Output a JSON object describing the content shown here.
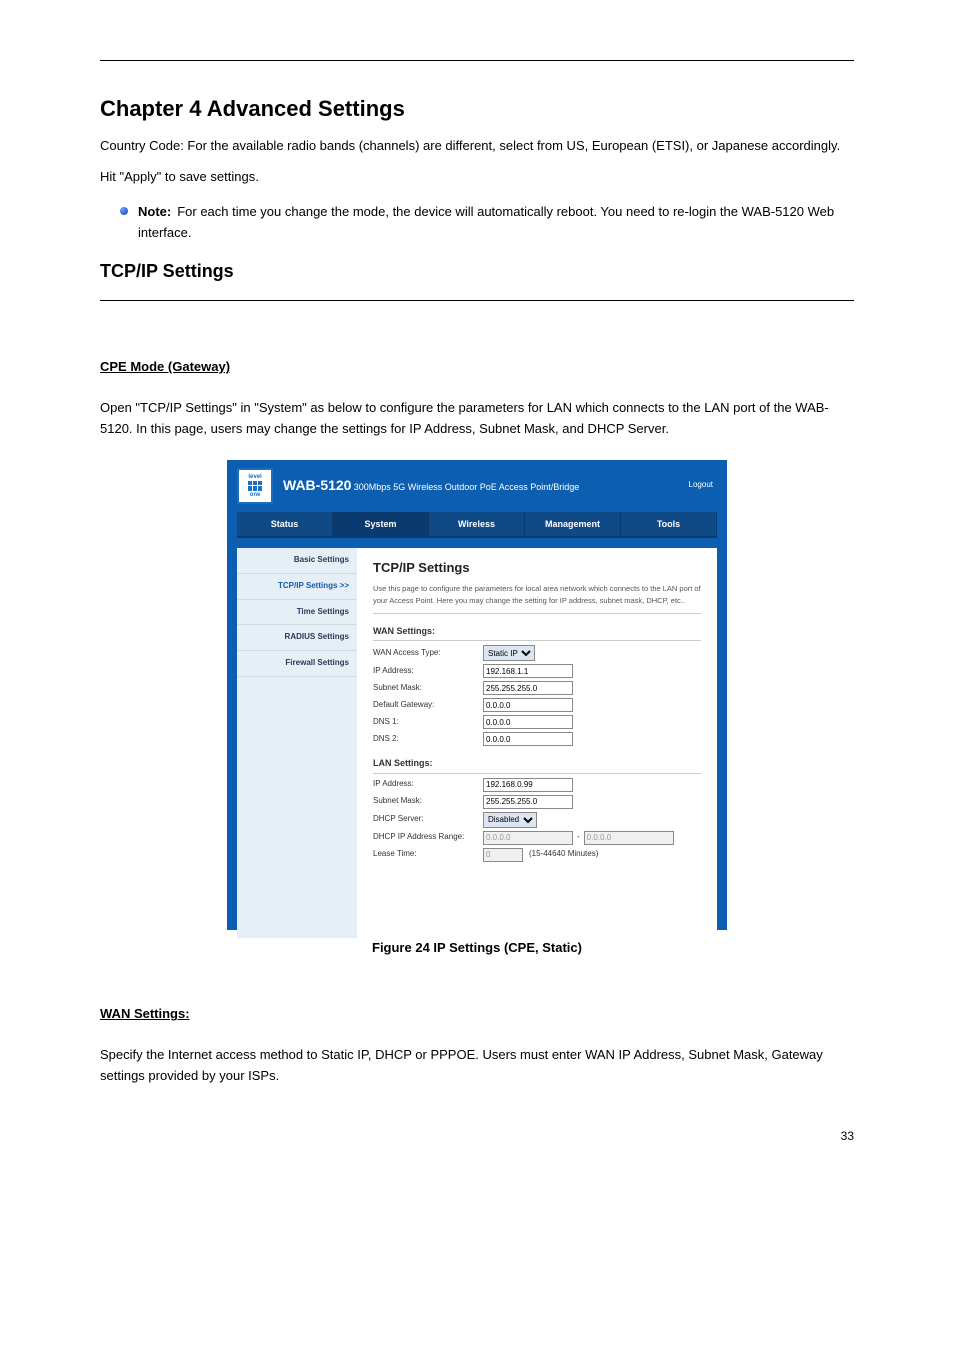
{
  "header": {
    "chapter_title": "Chapter 4 Advanced Settings"
  },
  "intro": {
    "p1": "Country Code: For the available radio bands (channels) are different, select from US, European (ETSI), or Japanese accordingly.",
    "p2_prefix": "Hit ",
    "p2_btn": "\"Apply\"",
    "p2_suffix": " to save settings."
  },
  "note": {
    "label": "Note:",
    "text": "For each time you change the mode, the device will automatically reboot. You need to re-login the WAB-5120 Web interface."
  },
  "tcpip": {
    "heading": "TCP/IP Settings",
    "cpe_heading": "CPE Mode (Gateway)",
    "cpe_text": "Open \"TCP/IP Settings\" in \"System\" as below to configure the parameters for LAN which connects to the LAN port of the WAB-5120. In this page, users may change the settings for IP Address, Subnet Mask, and DHCP Server.",
    "fig_caption": "Figure 24 IP Settings (CPE, Static)",
    "wan_heading": "WAN Settings:",
    "wan_text": "Specify the Internet access method to Static IP, DHCP or PPPOE. Users must enter WAN IP Address, Subnet Mask, Gateway settings provided by your ISPs."
  },
  "router": {
    "logo_top": "level",
    "logo_bottom": "one",
    "model": "WAB-5120",
    "desc": "300Mbps 5G Wireless Outdoor PoE Access Point/Bridge",
    "logout": "Logout",
    "tabs": {
      "status": "Status",
      "system": "System",
      "wireless": "Wireless",
      "management": "Management",
      "tools": "Tools"
    },
    "side": {
      "basic": "Basic Settings",
      "tcpip": "TCP/IP Settings  >>",
      "time": "Time Settings",
      "radius": "RADIUS Settings",
      "firewall": "Firewall Settings"
    },
    "panel": {
      "title": "TCP/IP Settings",
      "desc": "Use this page to configure the parameters for local area network which connects to the LAN port of your Access Point. Here you may change the setting for IP address, subnet mask, DHCP, etc..",
      "wan_title": "WAN Settings:",
      "lan_title": "LAN Settings:",
      "labels": {
        "wan_type": "WAN Access Type:",
        "ip": "IP Address:",
        "mask": "Subnet Mask:",
        "gw": "Default Gateway:",
        "dns1": "DNS 1:",
        "dns2": "DNS 2:",
        "dhcp": "DHCP Server:",
        "range": "DHCP IP Address Range:",
        "lease": "Lease Time:",
        "lease_unit": "(15-44640 Minutes)"
      },
      "values": {
        "wan_type": "Static IP",
        "wan_ip": "192.168.1.1",
        "wan_mask": "255.255.255.0",
        "wan_gw": "0.0.0.0",
        "dns1": "0.0.0.0",
        "dns2": "0.0.0.0",
        "lan_ip": "192.168.0.99",
        "lan_mask": "255.255.255.0",
        "dhcp": "Disabled",
        "range_from": "0.0.0.0",
        "range_to": "0.0.0.0",
        "lease": "0"
      }
    }
  },
  "page_num": "33"
}
